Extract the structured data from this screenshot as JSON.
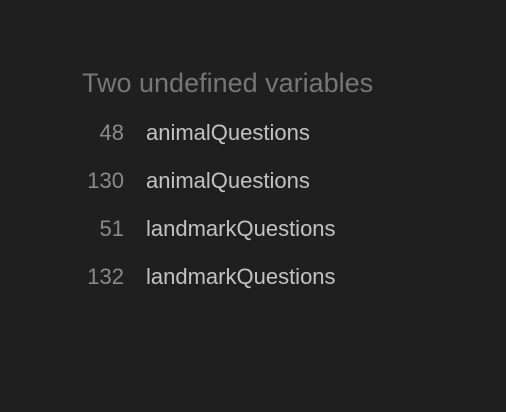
{
  "panel": {
    "title": "Two undefined variables",
    "items": [
      {
        "line": "48",
        "name": "animalQuestions"
      },
      {
        "line": "130",
        "name": "animalQuestions"
      },
      {
        "line": "51",
        "name": "landmarkQuestions"
      },
      {
        "line": "132",
        "name": "landmarkQuestions"
      }
    ]
  },
  "colors": {
    "background": "#1f1f1f",
    "title": "#767676",
    "line_number": "#8a8a8a",
    "variable": "#c2c2c2"
  }
}
